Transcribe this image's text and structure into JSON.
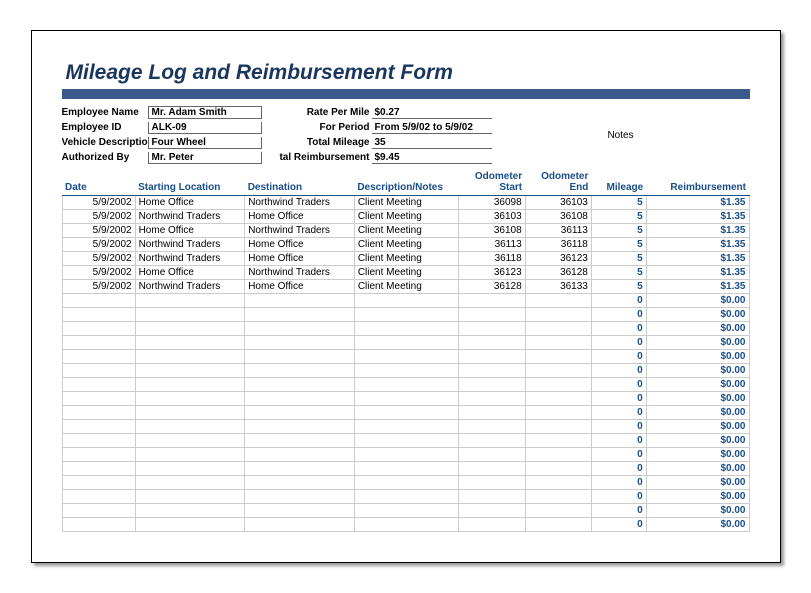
{
  "title": "Mileage Log and Reimbursement Form",
  "meta": {
    "left": [
      {
        "label": "Employee Name",
        "value": "Mr. Adam Smith"
      },
      {
        "label": "Employee ID",
        "value": "ALK-09"
      },
      {
        "label": "Vehicle Description",
        "value": "Four Wheel"
      },
      {
        "label": "Authorized By",
        "value": "Mr. Peter"
      }
    ],
    "mid": [
      {
        "label": "Rate Per Mile",
        "value": "$0.27"
      },
      {
        "label": "For Period",
        "value": "From 5/9/02 to 5/9/02"
      },
      {
        "label": "Total Mileage",
        "value": "35"
      },
      {
        "label": "tal Reimbursement",
        "value": "$9.45"
      }
    ],
    "notes_label": "Notes"
  },
  "columns": [
    "Date",
    "Starting Location",
    "Destination",
    "Description/Notes",
    "Odometer Start",
    "Odometer End",
    "Mileage",
    "Reimbursement"
  ],
  "rows": [
    {
      "date": "5/9/2002",
      "start": "Home Office",
      "dest": "Northwind Traders",
      "desc": "Client Meeting",
      "odos": "36098",
      "odoe": "36103",
      "mile": "5",
      "reim": "$1.35"
    },
    {
      "date": "5/9/2002",
      "start": "Northwind Traders",
      "dest": "Home Office",
      "desc": "Client Meeting",
      "odos": "36103",
      "odoe": "36108",
      "mile": "5",
      "reim": "$1.35"
    },
    {
      "date": "5/9/2002",
      "start": "Home Office",
      "dest": "Northwind Traders",
      "desc": "Client Meeting",
      "odos": "36108",
      "odoe": "36113",
      "mile": "5",
      "reim": "$1.35"
    },
    {
      "date": "5/9/2002",
      "start": "Northwind Traders",
      "dest": "Home Office",
      "desc": "Client Meeting",
      "odos": "36113",
      "odoe": "36118",
      "mile": "5",
      "reim": "$1.35"
    },
    {
      "date": "5/9/2002",
      "start": "Northwind Traders",
      "dest": "Home Office",
      "desc": "Client Meeting",
      "odos": "36118",
      "odoe": "36123",
      "mile": "5",
      "reim": "$1.35"
    },
    {
      "date": "5/9/2002",
      "start": "Home Office",
      "dest": "Northwind Traders",
      "desc": "Client Meeting",
      "odos": "36123",
      "odoe": "36128",
      "mile": "5",
      "reim": "$1.35"
    },
    {
      "date": "5/9/2002",
      "start": "Northwind Traders",
      "dest": "Home Office",
      "desc": "Client Meeting",
      "odos": "36128",
      "odoe": "36133",
      "mile": "5",
      "reim": "$1.35"
    },
    {
      "date": "",
      "start": "",
      "dest": "",
      "desc": "",
      "odos": "",
      "odoe": "",
      "mile": "0",
      "reim": "$0.00"
    },
    {
      "date": "",
      "start": "",
      "dest": "",
      "desc": "",
      "odos": "",
      "odoe": "",
      "mile": "0",
      "reim": "$0.00"
    },
    {
      "date": "",
      "start": "",
      "dest": "",
      "desc": "",
      "odos": "",
      "odoe": "",
      "mile": "0",
      "reim": "$0.00"
    },
    {
      "date": "",
      "start": "",
      "dest": "",
      "desc": "",
      "odos": "",
      "odoe": "",
      "mile": "0",
      "reim": "$0.00"
    },
    {
      "date": "",
      "start": "",
      "dest": "",
      "desc": "",
      "odos": "",
      "odoe": "",
      "mile": "0",
      "reim": "$0.00"
    },
    {
      "date": "",
      "start": "",
      "dest": "",
      "desc": "",
      "odos": "",
      "odoe": "",
      "mile": "0",
      "reim": "$0.00"
    },
    {
      "date": "",
      "start": "",
      "dest": "",
      "desc": "",
      "odos": "",
      "odoe": "",
      "mile": "0",
      "reim": "$0.00"
    },
    {
      "date": "",
      "start": "",
      "dest": "",
      "desc": "",
      "odos": "",
      "odoe": "",
      "mile": "0",
      "reim": "$0.00"
    },
    {
      "date": "",
      "start": "",
      "dest": "",
      "desc": "",
      "odos": "",
      "odoe": "",
      "mile": "0",
      "reim": "$0.00"
    },
    {
      "date": "",
      "start": "",
      "dest": "",
      "desc": "",
      "odos": "",
      "odoe": "",
      "mile": "0",
      "reim": "$0.00"
    },
    {
      "date": "",
      "start": "",
      "dest": "",
      "desc": "",
      "odos": "",
      "odoe": "",
      "mile": "0",
      "reim": "$0.00"
    },
    {
      "date": "",
      "start": "",
      "dest": "",
      "desc": "",
      "odos": "",
      "odoe": "",
      "mile": "0",
      "reim": "$0.00"
    },
    {
      "date": "",
      "start": "",
      "dest": "",
      "desc": "",
      "odos": "",
      "odoe": "",
      "mile": "0",
      "reim": "$0.00"
    },
    {
      "date": "",
      "start": "",
      "dest": "",
      "desc": "",
      "odos": "",
      "odoe": "",
      "mile": "0",
      "reim": "$0.00"
    },
    {
      "date": "",
      "start": "",
      "dest": "",
      "desc": "",
      "odos": "",
      "odoe": "",
      "mile": "0",
      "reim": "$0.00"
    },
    {
      "date": "",
      "start": "",
      "dest": "",
      "desc": "",
      "odos": "",
      "odoe": "",
      "mile": "0",
      "reim": "$0.00"
    },
    {
      "date": "",
      "start": "",
      "dest": "",
      "desc": "",
      "odos": "",
      "odoe": "",
      "mile": "0",
      "reim": "$0.00"
    }
  ]
}
